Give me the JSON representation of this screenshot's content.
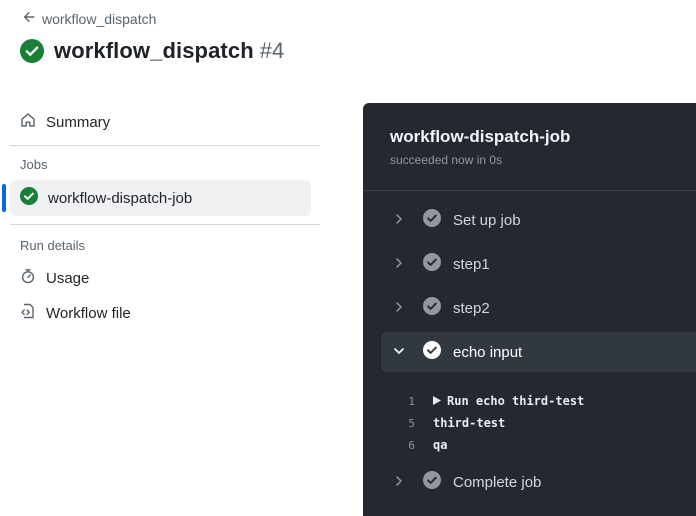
{
  "header": {
    "back_label": "workflow_dispatch",
    "title": "workflow_dispatch",
    "run_number": "#4"
  },
  "sidebar": {
    "summary_label": "Summary",
    "jobs_heading": "Jobs",
    "job_label": "workflow-dispatch-job",
    "run_details_heading": "Run details",
    "usage_label": "Usage",
    "workflow_file_label": "Workflow file"
  },
  "job_panel": {
    "title": "workflow-dispatch-job",
    "status": "succeeded now in 0s",
    "steps": [
      {
        "label": "Set up job",
        "expanded": false
      },
      {
        "label": "step1",
        "expanded": false
      },
      {
        "label": "step2",
        "expanded": false
      },
      {
        "label": "echo input",
        "expanded": true
      },
      {
        "label": "Complete job",
        "expanded": false
      }
    ],
    "log_lines": [
      {
        "num": "1",
        "text": "Run echo third-test",
        "collapsible": true
      },
      {
        "num": "5",
        "text": "third-test",
        "collapsible": false
      },
      {
        "num": "6",
        "text": "qa",
        "collapsible": false
      }
    ]
  },
  "colors": {
    "success": "#1a7f37",
    "accent": "#0969da",
    "panel_bg": "#24292f"
  },
  "icons": {
    "back": "arrow-left-icon",
    "status": "check-circle-fill-icon",
    "summary": "home-icon",
    "usage": "stopwatch-icon",
    "workflow_file": "file-code-icon"
  }
}
